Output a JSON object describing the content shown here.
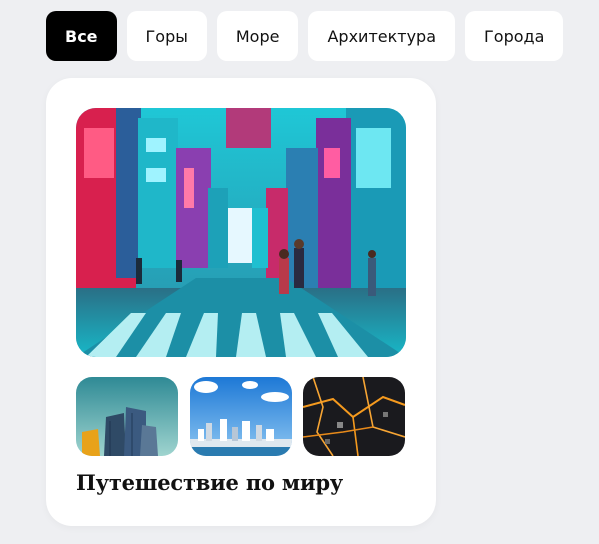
{
  "filters": [
    {
      "label": "Все",
      "active": true
    },
    {
      "label": "Горы",
      "active": false
    },
    {
      "label": "Море",
      "active": false
    },
    {
      "label": "Архитектура",
      "active": false
    },
    {
      "label": "Города",
      "active": false
    }
  ],
  "card": {
    "title": "Путешествие по миру"
  },
  "colors": {
    "active_chip": "#000000",
    "chip": "#ffffff",
    "background": "#eeeff2"
  }
}
